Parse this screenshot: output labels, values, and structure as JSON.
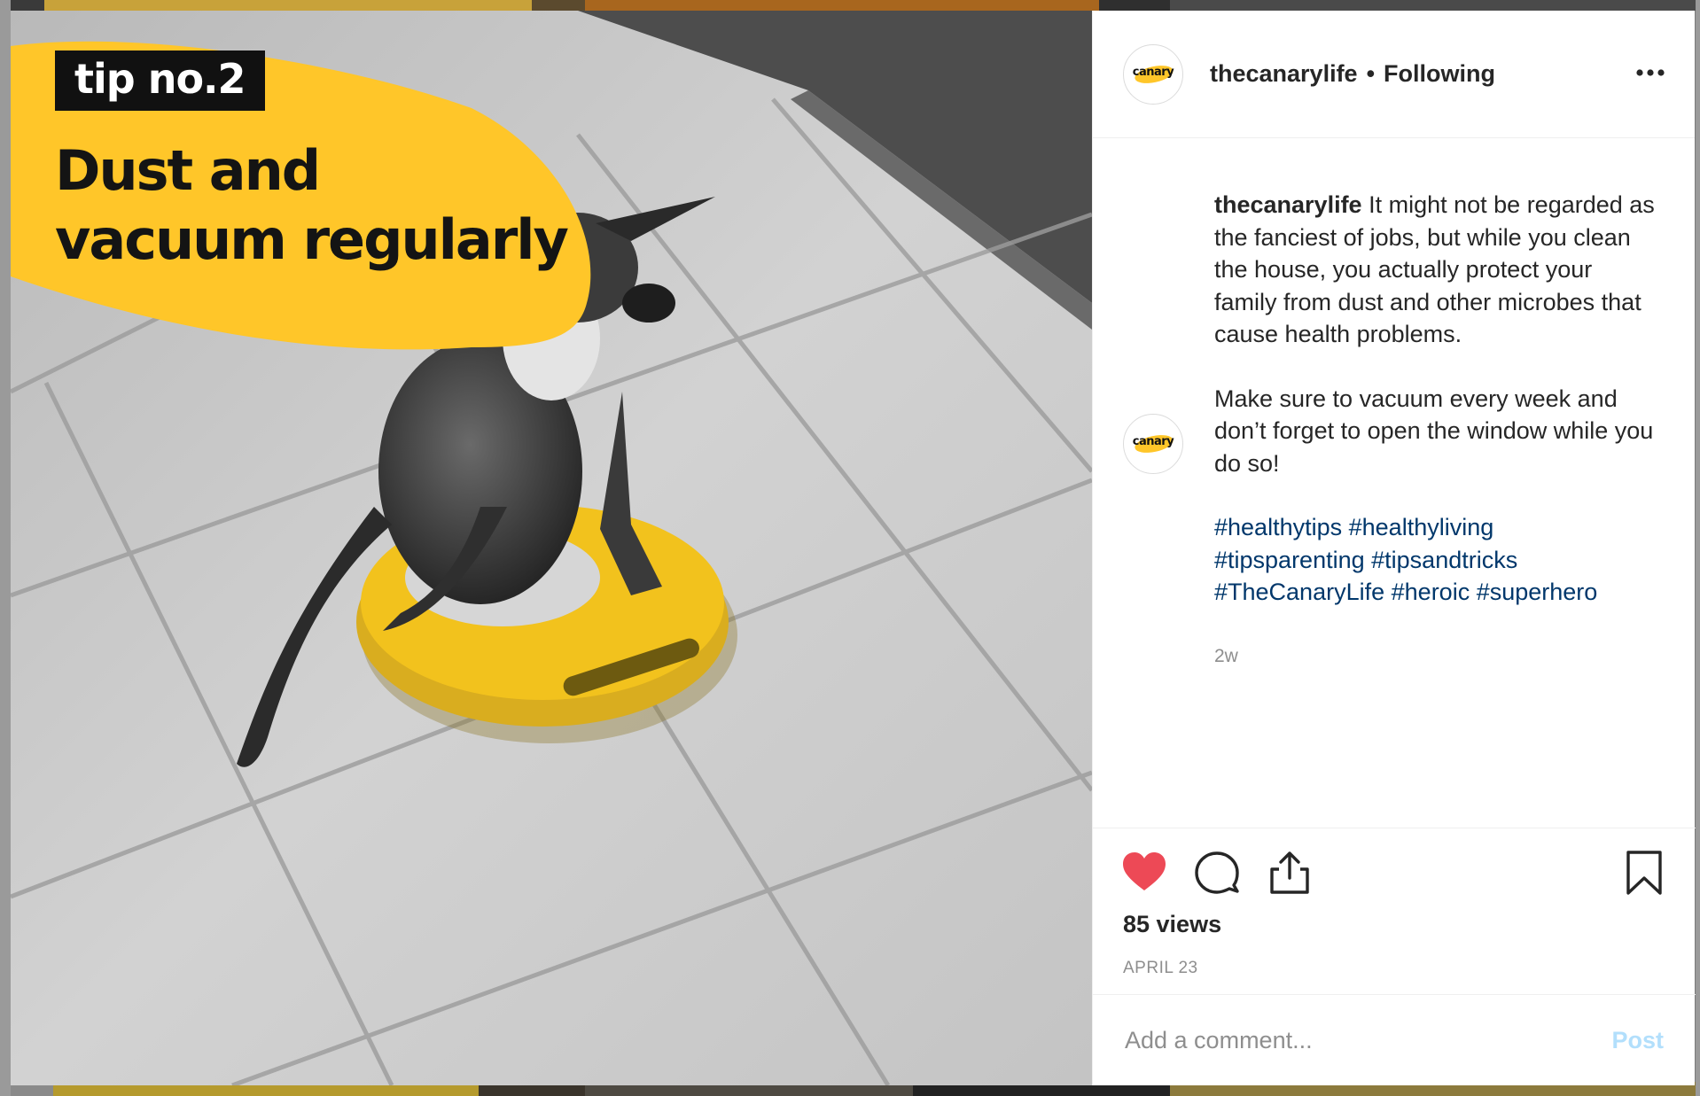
{
  "colors": {
    "brand_yellow": "#ffc629",
    "like_red": "#ed4956",
    "hashtag_blue": "#00376b",
    "muted_text": "#8e8e8e",
    "post_disabled_blue": "#b2dffc"
  },
  "media": {
    "badge": "tip no.2",
    "headline": [
      "Dust and",
      "vacuum regularly"
    ]
  },
  "post": {
    "avatar_logo": "canary",
    "username": "thecanarylife",
    "separator": "•",
    "follow_status": "Following",
    "more_icon": "ellipsis-icon"
  },
  "caption": {
    "username": "thecanarylife",
    "text": "It might not be regarded as the fanciest of jobs, but while you clean the house, you actually protect your family from dust and other microbes that cause health problems.",
    "followup": "Make sure to vacuum every week and don’t forget to open the window while you do so!",
    "hashtags": [
      "#healthytips",
      "#healthyliving",
      "#tipsparenting",
      "#tipsandtricks",
      "#TheCanaryLife",
      "#heroic",
      "#superhero"
    ],
    "age": "2w"
  },
  "actions": {
    "icons": [
      "heart-filled-icon",
      "comment-icon",
      "share-icon",
      "bookmark-icon"
    ],
    "liked": true,
    "views": "85 views",
    "date": "APRIL 23"
  },
  "comment_form": {
    "placeholder": "Add a comment...",
    "post_label": "Post"
  }
}
